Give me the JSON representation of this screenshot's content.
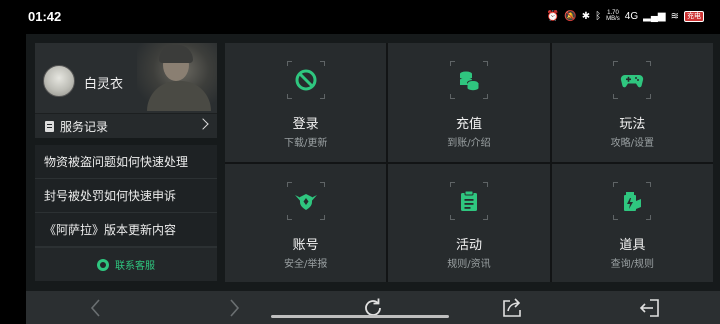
{
  "status_bar": {
    "time": "01:42",
    "speed_top": "1.70",
    "speed_bottom": "MB/s",
    "network": "4G",
    "battery": "充电"
  },
  "profile": {
    "username": "白灵衣",
    "service_record_label": "服务记录"
  },
  "faq": {
    "items": [
      {
        "label": "物资被盗问题如何快速处理"
      },
      {
        "label": "封号被处罚如何快速申诉"
      },
      {
        "label": "《阿萨拉》版本更新内容"
      }
    ],
    "contact_label": "联系客服"
  },
  "grid": {
    "accent_color": "#2fc67f",
    "cells": [
      {
        "title": "登录",
        "subtitle": "下载/更新",
        "icon": "ban-icon"
      },
      {
        "title": "充值",
        "subtitle": "到账/介绍",
        "icon": "coins-icon"
      },
      {
        "title": "玩法",
        "subtitle": "攻略/设置",
        "icon": "gamepad-icon"
      },
      {
        "title": "账号",
        "subtitle": "安全/举报",
        "icon": "wings-shield-icon"
      },
      {
        "title": "活动",
        "subtitle": "规则/资讯",
        "icon": "clipboard-icon"
      },
      {
        "title": "道具",
        "subtitle": "查询/规则",
        "icon": "battery-item-icon"
      }
    ]
  },
  "navbar": {
    "buttons": [
      "back-icon",
      "forward-icon",
      "refresh-icon",
      "share-icon",
      "exit-icon"
    ]
  }
}
